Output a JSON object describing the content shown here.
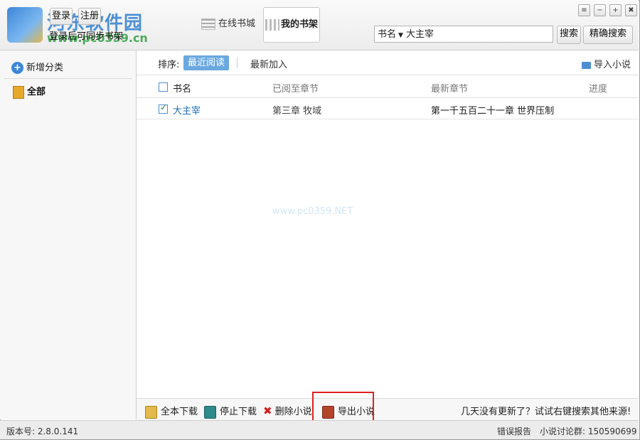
{
  "header": {
    "watermark_title": "河东软件园",
    "watermark_url": "www.pc0359.cn",
    "login_label": "登录",
    "register_label": "注册",
    "sync_text": "登录后可同步书架",
    "tab_online": "在线书城",
    "tab_shelf": "我的书架",
    "search_type": "书名",
    "search_value": "大主宰",
    "search_button": "搜索",
    "exact_search_button": "精确搜索",
    "window_controls": [
      "menu-icon",
      "minimize-icon",
      "maximize-icon",
      "close-icon"
    ]
  },
  "sidebar": {
    "add_category": "新增分类",
    "all_category": "全部"
  },
  "sortbar": {
    "label": "排序:",
    "recent_read": "最近阅读",
    "recent_added": "最新加入",
    "import_novel": "导入小说"
  },
  "table": {
    "columns": [
      "书名",
      "已阅至章节",
      "最新章节",
      "进度"
    ],
    "rows": [
      {
        "checked": true,
        "title": "大主宰",
        "read_to": "第三章 牧域",
        "latest": "第一千五百二十一章 世界压制",
        "progress": ""
      }
    ]
  },
  "center_watermark": "www.pc0359.NET",
  "toolbar": {
    "download_all": "全本下载",
    "stop_download": "停止下载",
    "delete_novel": "删除小说",
    "export_novel": "导出小说",
    "hint": "几天没有更新了？试试右键搜索其他来源!"
  },
  "statusbar": {
    "version": "版本号: 2.8.0.141",
    "error_report": "错误报告",
    "discussion_group": "小说讨论群: 150590699"
  },
  "colors": {
    "accent": "#6aa8e0",
    "highlight": "#e02020",
    "title_link": "#1f6fb5"
  }
}
